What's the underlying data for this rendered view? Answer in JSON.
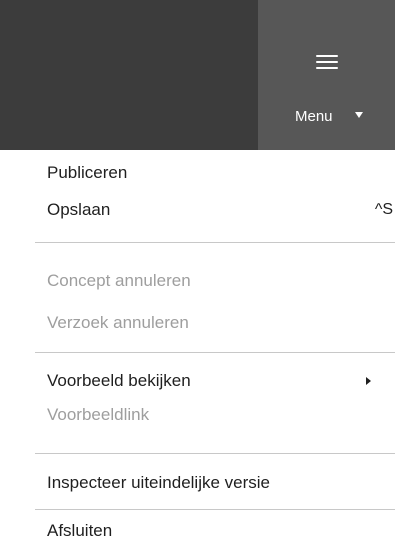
{
  "menu_button": {
    "label": "Menu"
  },
  "items": [
    {
      "label": "Publiceren",
      "enabled": true
    },
    {
      "label": "Opslaan",
      "shortcut": "^S",
      "enabled": true
    },
    {
      "label": "Concept annuleren",
      "enabled": false
    },
    {
      "label": "Verzoek annuleren",
      "enabled": false
    },
    {
      "label": "Voorbeeld bekijken",
      "has_submenu": true,
      "enabled": true
    },
    {
      "label": "Voorbeeldlink",
      "enabled": false
    },
    {
      "label": "Inspecteer uiteindelijke versie",
      "enabled": true
    },
    {
      "label": "Afsluiten",
      "enabled": true
    }
  ],
  "colors": {
    "topbar": "#3c3c3c",
    "menu_button_bg": "#575757",
    "text": "#1f1f1f",
    "disabled_text": "#9e9e9e",
    "divider": "#c8c8c8"
  }
}
